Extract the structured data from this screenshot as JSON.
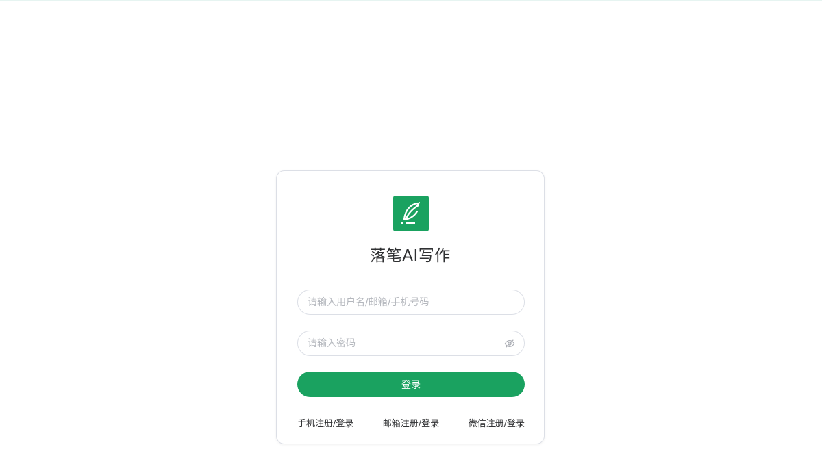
{
  "app": {
    "title": "落笔AI写作",
    "logo_icon": "feather-pen-icon",
    "brand_color": "#1aa260"
  },
  "login_form": {
    "username_placeholder": "请输入用户名/邮箱/手机号码",
    "username_value": "",
    "password_placeholder": "请输入密码",
    "password_value": "",
    "password_toggle_icon": "eye-icon",
    "submit_label": "登录"
  },
  "register_links": [
    {
      "label": "手机注册/登录"
    },
    {
      "label": "邮箱注册/登录"
    },
    {
      "label": "微信注册/登录"
    }
  ]
}
